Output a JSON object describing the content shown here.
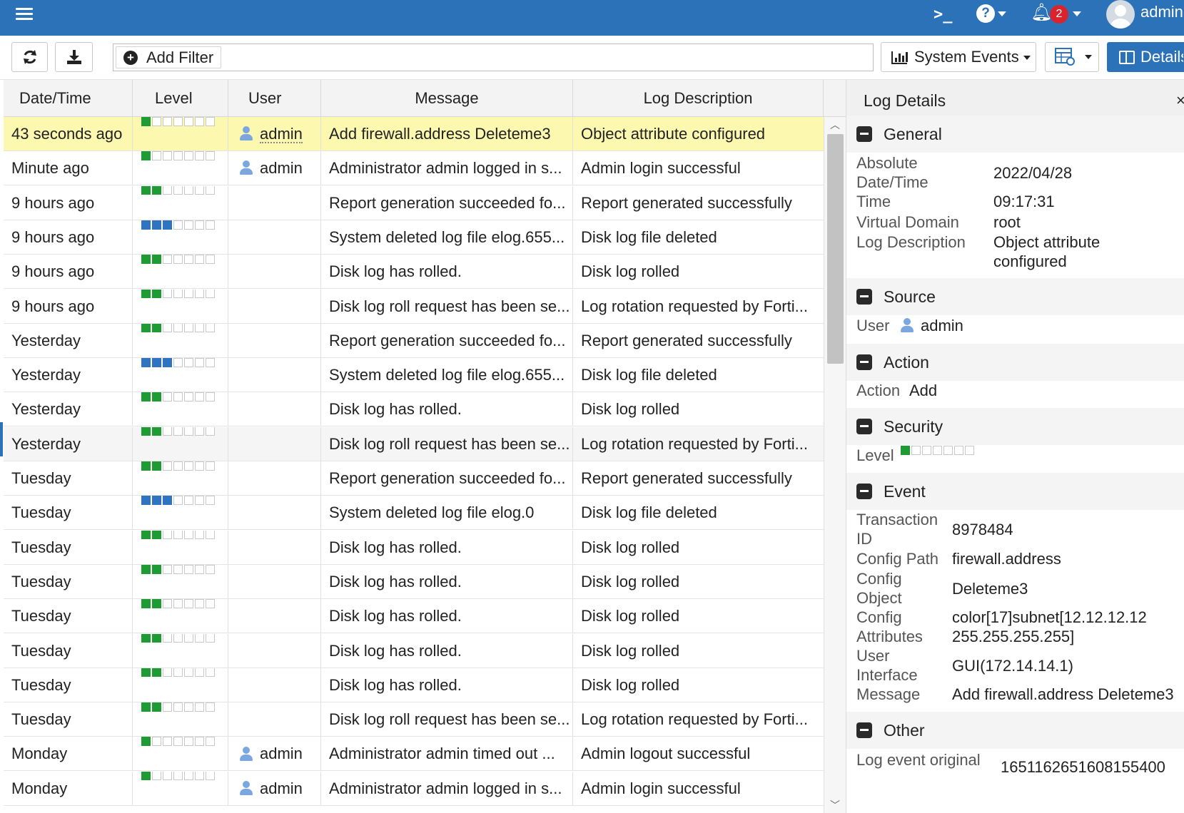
{
  "topbar": {
    "notification_count": "2",
    "username": "admin",
    "icons": [
      "menu-icon",
      "cli-console-icon",
      "help-icon",
      "bell-icon",
      "user-avatar-icon"
    ]
  },
  "toolbar": {
    "add_filter_label": "Add Filter",
    "view_selector_label": "System Events",
    "details_label": "Details",
    "icons": [
      "refresh-icon",
      "download-icon",
      "plus-circle-icon",
      "bar-chart-icon",
      "table-view-icon",
      "panel-icon"
    ]
  },
  "table": {
    "columns": [
      "Date/Time",
      "Level",
      "User",
      "Message",
      "Log Description"
    ],
    "rows": [
      {
        "date": "43 seconds ago",
        "level": 1,
        "level_color": "#1e9b33",
        "user": "admin",
        "message": "Add firewall.address Deleteme3",
        "description": "Object attribute configured"
      },
      {
        "date": "Minute ago",
        "level": 1,
        "level_color": "#1e9b33",
        "user": "admin",
        "message": "Administrator admin logged in s...",
        "description": "Admin login successful"
      },
      {
        "date": "9 hours ago",
        "level": 2,
        "level_color": "#1e9b33",
        "user": "",
        "message": "Report generation succeeded fo...",
        "description": "Report generated successfully"
      },
      {
        "date": "9 hours ago",
        "level": 3,
        "level_color": "#2f74c0",
        "user": "",
        "message": "System deleted log file elog.655...",
        "description": "Disk log file deleted"
      },
      {
        "date": "9 hours ago",
        "level": 2,
        "level_color": "#1e9b33",
        "user": "",
        "message": "Disk log has rolled.",
        "description": "Disk log rolled"
      },
      {
        "date": "9 hours ago",
        "level": 2,
        "level_color": "#1e9b33",
        "user": "",
        "message": "Disk log roll request has been se...",
        "description": "Log rotation requested by Forti..."
      },
      {
        "date": "Yesterday",
        "level": 2,
        "level_color": "#1e9b33",
        "user": "",
        "message": "Report generation succeeded fo...",
        "description": "Report generated successfully"
      },
      {
        "date": "Yesterday",
        "level": 3,
        "level_color": "#2f74c0",
        "user": "",
        "message": "System deleted log file elog.655...",
        "description": "Disk log file deleted"
      },
      {
        "date": "Yesterday",
        "level": 2,
        "level_color": "#1e9b33",
        "user": "",
        "message": "Disk log has rolled.",
        "description": "Disk log rolled"
      },
      {
        "date": "Yesterday",
        "level": 2,
        "level_color": "#1e9b33",
        "user": "",
        "message": "Disk log roll request has been se...",
        "description": "Log rotation requested by Forti..."
      },
      {
        "date": "Tuesday",
        "level": 2,
        "level_color": "#1e9b33",
        "user": "",
        "message": "Report generation succeeded fo...",
        "description": "Report generated successfully"
      },
      {
        "date": "Tuesday",
        "level": 3,
        "level_color": "#2f74c0",
        "user": "",
        "message": "System deleted log file elog.0",
        "description": "Disk log file deleted"
      },
      {
        "date": "Tuesday",
        "level": 2,
        "level_color": "#1e9b33",
        "user": "",
        "message": "Disk log has rolled.",
        "description": "Disk log rolled"
      },
      {
        "date": "Tuesday",
        "level": 2,
        "level_color": "#1e9b33",
        "user": "",
        "message": "Disk log has rolled.",
        "description": "Disk log rolled"
      },
      {
        "date": "Tuesday",
        "level": 2,
        "level_color": "#1e9b33",
        "user": "",
        "message": "Disk log has rolled.",
        "description": "Disk log rolled"
      },
      {
        "date": "Tuesday",
        "level": 2,
        "level_color": "#1e9b33",
        "user": "",
        "message": "Disk log has rolled.",
        "description": "Disk log rolled"
      },
      {
        "date": "Tuesday",
        "level": 2,
        "level_color": "#1e9b33",
        "user": "",
        "message": "Disk log has rolled.",
        "description": "Disk log rolled"
      },
      {
        "date": "Tuesday",
        "level": 2,
        "level_color": "#1e9b33",
        "user": "",
        "message": "Disk log roll request has been se...",
        "description": "Log rotation requested by Forti..."
      },
      {
        "date": "Monday",
        "level": 1,
        "level_color": "#1e9b33",
        "user": "admin",
        "message": "Administrator admin timed out ...",
        "description": "Admin logout successful"
      },
      {
        "date": "Monday",
        "level": 1,
        "level_color": "#1e9b33",
        "user": "admin",
        "message": "Administrator admin logged in s...",
        "description": "Admin login successful"
      }
    ],
    "selected_row": 0,
    "level_max": 7
  },
  "details": {
    "title": "Log Details",
    "general": {
      "title": "General",
      "absolute_datetime_label": "Absolute Date/Time",
      "absolute_datetime_value": "2022/04/28",
      "time_label": "Time",
      "time_value": "09:17:31",
      "vdom_label": "Virtual Domain",
      "vdom_value": "root",
      "logdesc_label": "Log Description",
      "logdesc_value": "Object attribute configured"
    },
    "source": {
      "title": "Source",
      "user_label": "User",
      "user_value": "admin"
    },
    "action": {
      "title": "Action",
      "action_label": "Action",
      "action_value": "Add"
    },
    "security": {
      "title": "Security",
      "level_label": "Level",
      "level_value": 1
    },
    "event": {
      "title": "Event",
      "txid_label": "Transaction ID",
      "txid_value": "8978484",
      "cfgpath_label": "Config Path",
      "cfgpath_value": "firewall.address",
      "cfgobj_label": "Config Object",
      "cfgobj_value": "Deleteme3",
      "cfgattr_label": "Config Attributes",
      "cfgattr_value": "color[17]subnet[12.12.12.12 255.255.255.255]",
      "ui_label": "User Interface",
      "ui_value": "GUI(172.14.14.1)",
      "msg_label": "Message",
      "msg_value": "Add firewall.address Deleteme3"
    },
    "other": {
      "title": "Other",
      "orig_label": "Log event original",
      "orig_value": "1651162651608155400"
    }
  }
}
